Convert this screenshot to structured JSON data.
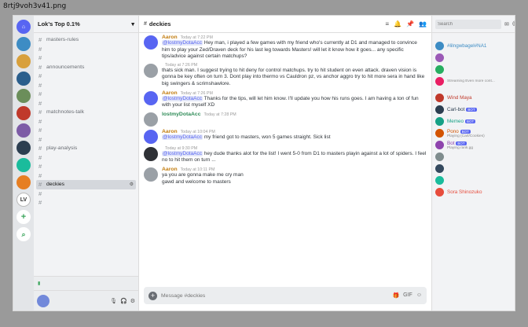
{
  "file_label": "8rtj9voh3v41.png",
  "colors": {
    "accent": "#5865f2",
    "online": "#3ba55c",
    "mention_bg": "#e3e7f8"
  },
  "rail": {
    "servers": [
      {
        "label": "⌂",
        "kind": "home",
        "icon": "discord-home-icon"
      },
      {
        "label": "",
        "kind": "img",
        "color": "#3d8cc4",
        "icon": "server-icon"
      },
      {
        "label": "",
        "kind": "img",
        "color": "#d8a03c",
        "icon": "server-icon"
      },
      {
        "label": "",
        "kind": "img",
        "color": "#2a5e8c",
        "icon": "server-icon"
      },
      {
        "label": "",
        "kind": "img",
        "color": "#6b8e5a",
        "icon": "server-icon"
      },
      {
        "label": "",
        "kind": "img",
        "color": "#c0392b",
        "icon": "server-icon"
      },
      {
        "label": "",
        "kind": "img",
        "color": "#7d5ba6",
        "icon": "server-icon"
      },
      {
        "label": "",
        "kind": "img",
        "color": "#2c3e50",
        "icon": "server-icon"
      },
      {
        "label": "",
        "kind": "img",
        "color": "#1abc9c",
        "icon": "server-icon"
      },
      {
        "label": "",
        "kind": "img",
        "color": "#e67e22",
        "icon": "server-icon"
      },
      {
        "label": "LV",
        "kind": "lv",
        "icon": "server-icon"
      },
      {
        "label": "+",
        "kind": "add",
        "icon": "add-server-icon"
      },
      {
        "label": "⌕",
        "kind": "find",
        "icon": "explore-servers-icon"
      }
    ]
  },
  "sidebar": {
    "server_name": "Lok's Top 0.1%",
    "channels": [
      {
        "name": "masters-rules",
        "active": false
      },
      {
        "name": "",
        "active": false
      },
      {
        "name": "",
        "active": false
      },
      {
        "name": "announcements",
        "active": false
      },
      {
        "name": "",
        "active": false
      },
      {
        "name": "",
        "active": false
      },
      {
        "name": "",
        "active": false
      },
      {
        "name": "",
        "active": false
      },
      {
        "name": "matchnotes-talk",
        "active": false
      },
      {
        "name": "",
        "active": false
      },
      {
        "name": "",
        "active": false
      },
      {
        "name": "",
        "active": false
      },
      {
        "name": "play-analysis",
        "active": false
      },
      {
        "name": "",
        "active": false
      },
      {
        "name": "",
        "active": false
      },
      {
        "name": "",
        "active": false
      },
      {
        "name": "deckies",
        "active": true
      },
      {
        "name": "",
        "active": false
      },
      {
        "name": "",
        "active": false
      }
    ],
    "voice_status": "",
    "user": {
      "name": "",
      "tag": ""
    }
  },
  "chat": {
    "channel": "deckies",
    "messages": [
      {
        "author": "Aaron",
        "color": "orange",
        "stamp": "Today at 7:22 PM",
        "avatar": "blurple",
        "text": "@lostmyDotaAcc Hey man, i played a few games with my friend who's currently at D1 and managed to convince him to play your Zed/Draven deck for his last leg towards Masters! will let it know how it goes... any specific tips/advice against certain matchups?"
      },
      {
        "author": "",
        "color": "orange",
        "stamp": "Today at 7:26 PM",
        "avatar": "grey",
        "text": "thats sick man. I suggest trying to hit deny for control matchups. try to hit student on even attack. draven vision is gonna be key often on turn 3. Dont play into thermo vs Cauldron pz, vs anchor aggro try to hit more sera in hand like big swingers & scrimshawlore."
      },
      {
        "author": "Aaron",
        "color": "orange",
        "stamp": "Today at 7:26 PM",
        "avatar": "blurple",
        "text": "@lostmyDotaAcc Thanks for the tips, will let him know. I'll update you how his runs goes. I am having a ton of fun with your list myself XD"
      },
      {
        "author": "lostmyDotaAcc",
        "color": "green",
        "stamp": "Today at 7:28 PM",
        "avatar": "grey",
        "text": ""
      },
      {
        "author": "Aaron",
        "color": "orange",
        "stamp": "Today at 10:04 PM",
        "avatar": "blurple",
        "text": "@lostmyDotaAcc my friend got to masters, won 5 games straight. Sick list"
      },
      {
        "author": "",
        "color": "orange",
        "stamp": "Today at 9:30 PM",
        "avatar": "dark",
        "text": "@lostmyDotaAcc hey dude thanks alot for the list! I went 5-0 from D1 to masters playin against a lot of spiders. I feel no to hit them on turn ..."
      },
      {
        "author": "Aaron",
        "color": "orange",
        "stamp": "Today at 10:11 PM",
        "avatar": "grey",
        "text": "ya you are gonna make me cry man\ngawd and welcome to masters"
      }
    ],
    "composer_placeholder": "Message #deckies"
  },
  "members": {
    "search_placeholder": "Search",
    "groups": [
      {
        "title": "",
        "items": [
          {
            "name": "#lilngwbagel#NA1",
            "status": "",
            "color": "#3d8cc4",
            "bot": false
          },
          {
            "name": "",
            "status": "",
            "color": "#9b59b6",
            "bot": false
          },
          {
            "name": "",
            "status": "",
            "color": "#27ae60",
            "bot": false
          },
          {
            "name": "",
            "status": "Streaming Even more cont...",
            "color": "#e91e63",
            "bot": false
          }
        ]
      },
      {
        "title": "",
        "items": [
          {
            "name": "Wind Maya",
            "status": "",
            "color": "#c0392b",
            "bot": false
          },
          {
            "name": "Carl-bot",
            "status": "",
            "color": "#2c3e50",
            "bot": true
          },
          {
            "name": "Memeo",
            "status": "",
            "color": "#16a085",
            "bot": true
          },
          {
            "name": "Pono",
            "status": "Playing (Carl/Cookies)",
            "color": "#d35400",
            "bot": true
          },
          {
            "name": "Bot",
            "status": "Playing rank.gg",
            "color": "#8e44ad",
            "bot": true
          },
          {
            "name": "",
            "status": "",
            "color": "#7f8c8d",
            "bot": false
          },
          {
            "name": "",
            "status": "",
            "color": "#34495e",
            "bot": false
          },
          {
            "name": "",
            "status": "",
            "color": "#1abc9c",
            "bot": false
          },
          {
            "name": "Sora Shinozuko",
            "status": "",
            "color": "#e74c3c",
            "bot": false
          }
        ]
      }
    ]
  }
}
